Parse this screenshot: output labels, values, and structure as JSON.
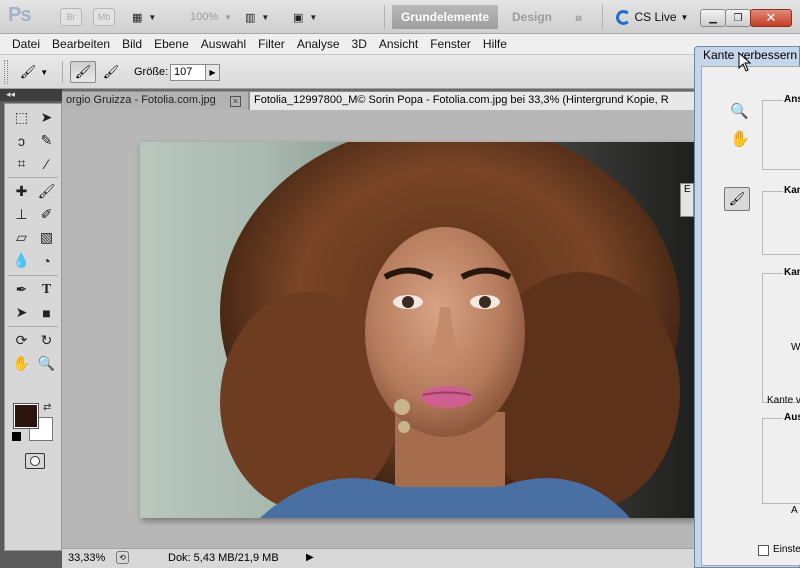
{
  "appbar": {
    "logo": "Ps",
    "bridge_label": "Br",
    "minibridge_label": "Mb",
    "zoom_value": "100%",
    "workspace_active": "Grundelemente",
    "workspace_other": "Design",
    "more_label": "»",
    "cslive_label": "CS Live"
  },
  "menu": [
    "Datei",
    "Bearbeiten",
    "Bild",
    "Ebene",
    "Auswahl",
    "Filter",
    "Analyse",
    "3D",
    "Ansicht",
    "Fenster",
    "Hilfe"
  ],
  "options": {
    "size_label": "Größe:",
    "size_value": "107"
  },
  "tabs": [
    {
      "label": "orgio Gruizza - Fotolia.com.jpg"
    },
    {
      "label": "Fotolia_12997800_M© Sorin Popa - Fotolia.com.jpg bei 33,3% (Hintergrund Kopie, R"
    }
  ],
  "tools_panel": {
    "collapse_label": "◂◂"
  },
  "colors": {
    "foreground": "#2a140c",
    "background": "#ffffff",
    "accent": "#1e6fcf"
  },
  "status": {
    "zoom": "33,33%",
    "doc_info": "Dok: 5,43 MB/21,9 MB"
  },
  "dialog": {
    "title": "Kante verbessern",
    "group1_title": "Ansi",
    "group2_title": "Kant",
    "group3_title": "Kant",
    "group3_sub1": "We",
    "group3_sub2": "Kante v",
    "group4_title": "Ausg",
    "group4_sub": "A",
    "checkbox_label": "Einstel"
  },
  "mini_popup_label": "E"
}
